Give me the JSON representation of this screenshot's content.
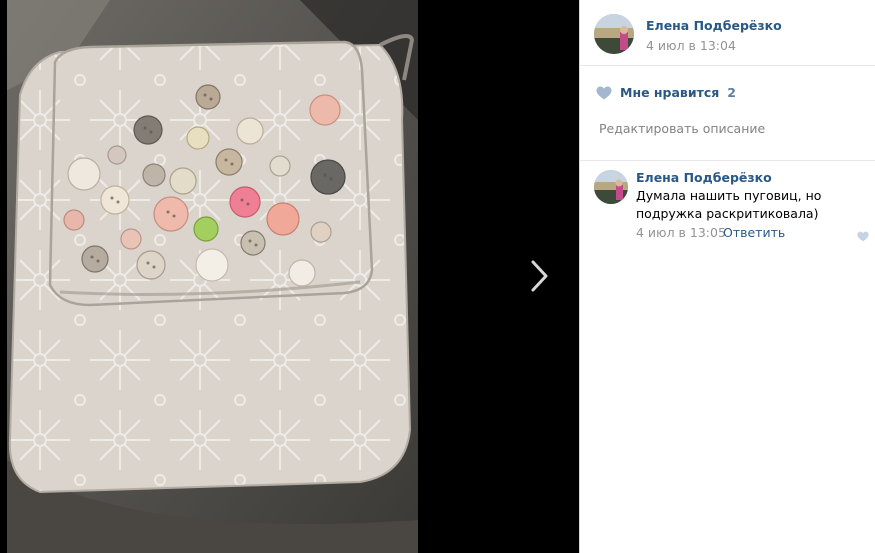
{
  "post": {
    "author": "Елена Подберёзко",
    "date": "4 июл в 13:04"
  },
  "likes": {
    "label": "Мне нравится",
    "count": "2"
  },
  "edit_description": "Редактировать описание",
  "comments": [
    {
      "author": "Елена Подберёзко",
      "text": "Думала нашить пуговиц, но подружка раскритиковала)",
      "date": "4 июл в 13:05",
      "reply_label": "Ответить"
    }
  ],
  "colors": {
    "link": "#2a5885",
    "meta": "#939393",
    "heart": "#a5b7cf",
    "backdrop": "#000000"
  },
  "icons": {
    "next": "chevron-right-icon",
    "like": "heart-icon"
  }
}
